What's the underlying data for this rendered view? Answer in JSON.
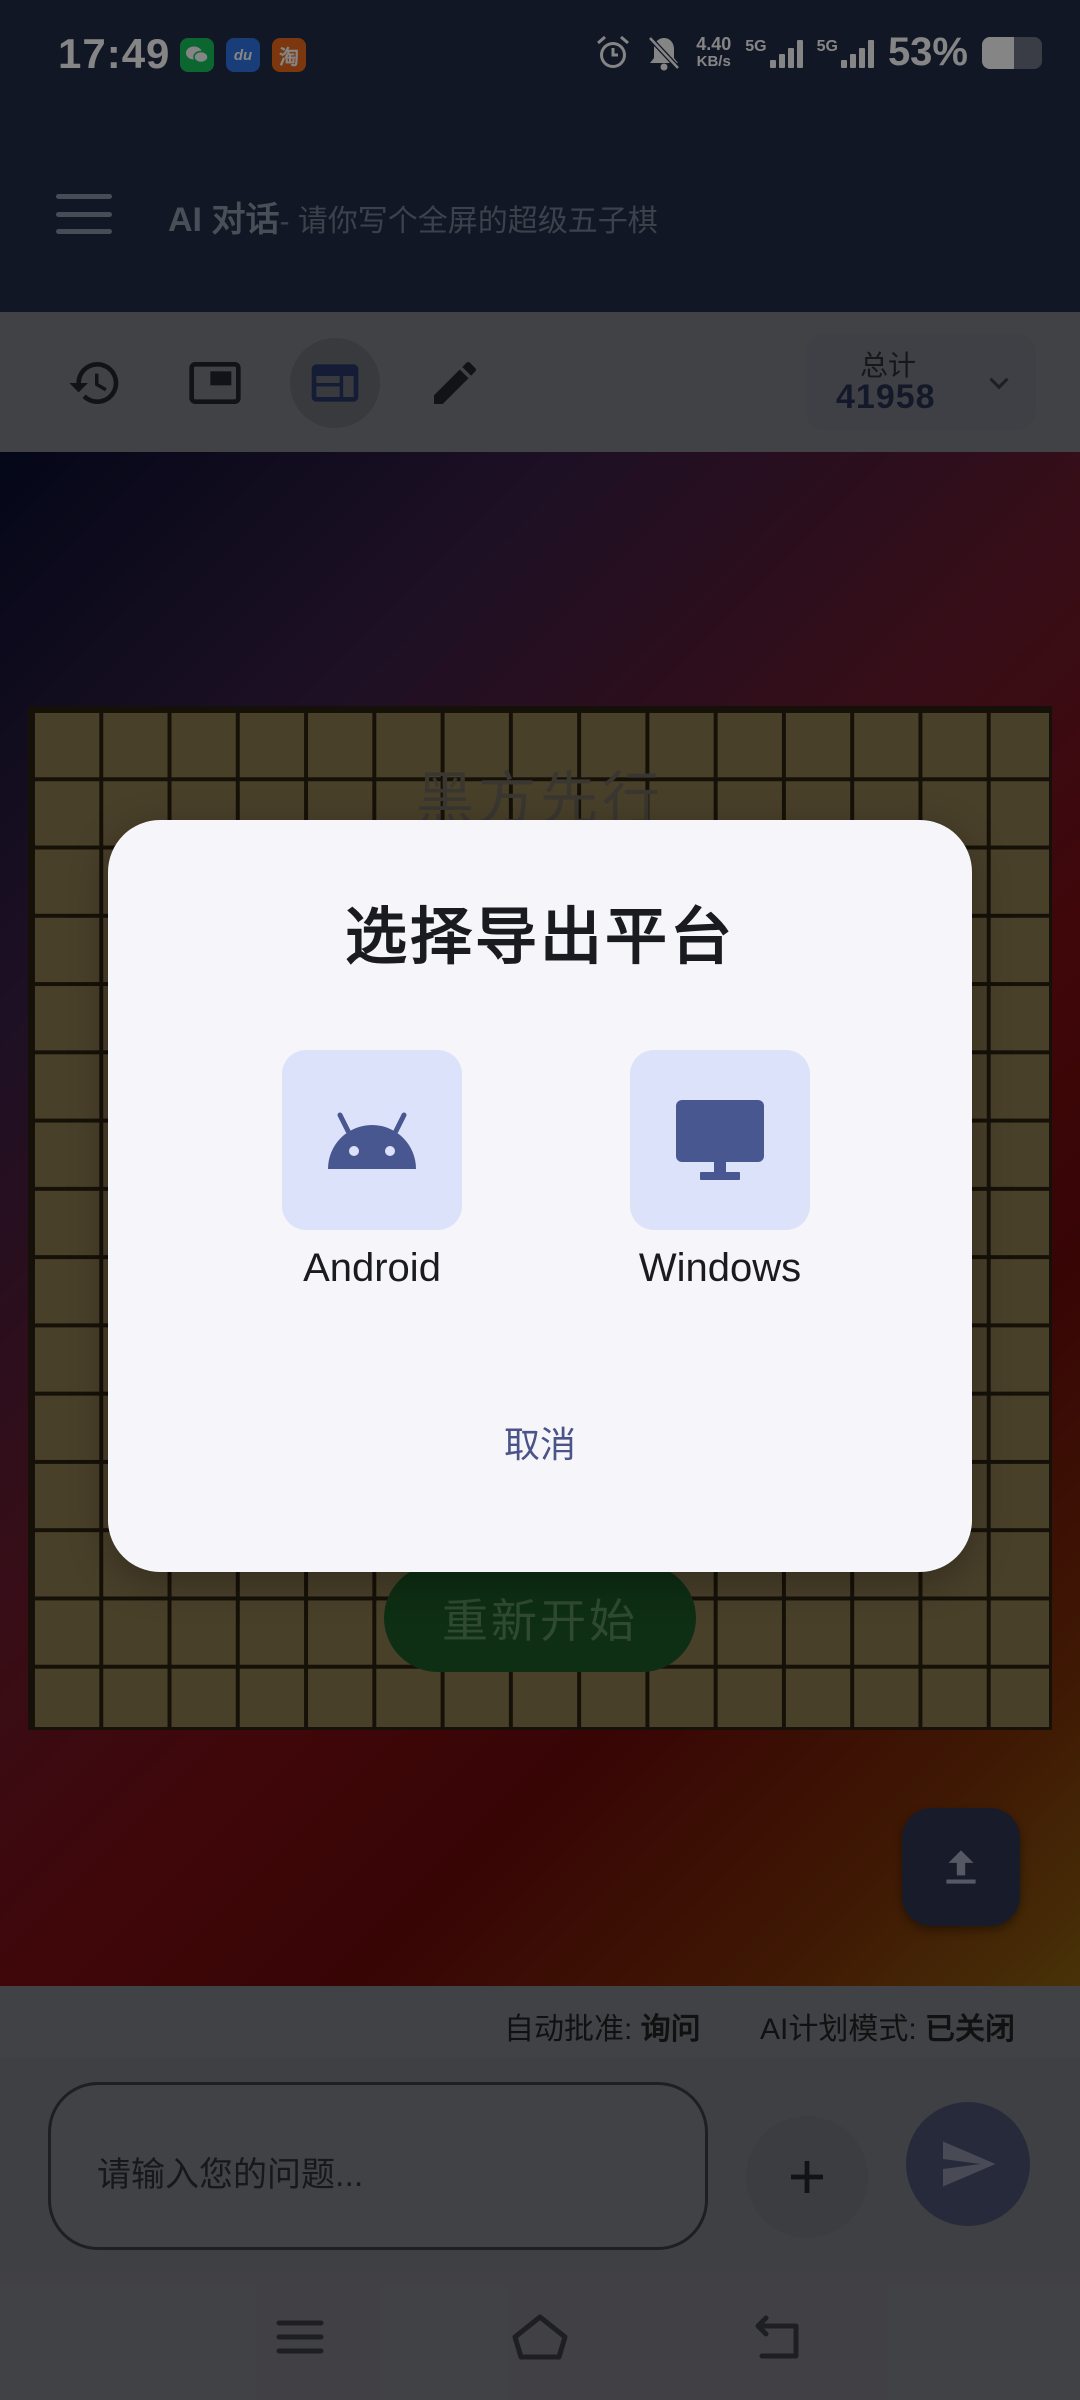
{
  "status_bar": {
    "time": "17:49",
    "apps": [
      {
        "name": "wechat-icon",
        "glyph": "●",
        "color": "#16c45c"
      },
      {
        "name": "baidu-icon",
        "glyph": "du",
        "color": "#2f76e6"
      },
      {
        "name": "taobao-icon",
        "glyph": "淘",
        "color": "#f06a1b"
      }
    ],
    "net_speed_value": "4.40",
    "net_speed_unit": "KB/s",
    "sim1": "5G",
    "sim2": "5G",
    "battery_percent": "53%",
    "battery_level": 0.53
  },
  "app_bar": {
    "title": "AI 对话",
    "subtitle": "- 请你写个全屏的超级五子棋"
  },
  "toolbar": {
    "total_label": "总计",
    "total_value": "41958"
  },
  "game": {
    "turn_text": "黑方先行",
    "restart_label": "重新开始",
    "grid_size": 15
  },
  "info_bar": {
    "auto_approve_label": "自动批准: ",
    "auto_approve_value": "询问",
    "plan_mode_label": "AI计划模式: ",
    "plan_mode_value": "已关闭"
  },
  "input": {
    "placeholder": "请输入您的问题..."
  },
  "dialog": {
    "title": "选择导出平台",
    "options": [
      {
        "label": "Android",
        "icon": "android-icon"
      },
      {
        "label": "Windows",
        "icon": "monitor-icon"
      }
    ],
    "cancel_label": "取消"
  },
  "colors": {
    "accent": "#4a5488",
    "tile_bg": "#dde2fb",
    "dialog_bg": "#f6f5fa"
  }
}
